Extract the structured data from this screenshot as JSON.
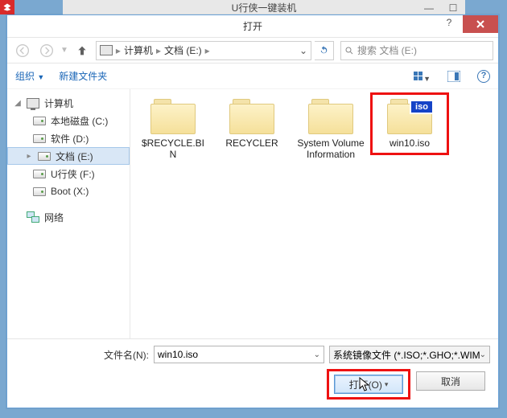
{
  "back_window": {
    "title": "U行侠一键装机",
    "icon_name": "app-logo"
  },
  "dialog": {
    "title": "打开",
    "help": "?",
    "breadcrumb": {
      "root_icon": "computer",
      "parts": [
        "计算机",
        "文档 (E:)"
      ]
    },
    "search_placeholder": "搜索 文档 (E:)",
    "toolbar": {
      "organize": "组织",
      "new_folder": "新建文件夹"
    },
    "tree": {
      "computer": "计算机",
      "drives": [
        {
          "label": "本地磁盘 (C:)"
        },
        {
          "label": "软件 (D:)"
        },
        {
          "label": "文档 (E:)",
          "selected": true
        },
        {
          "label": "U行侠 (F:)"
        },
        {
          "label": "Boot (X:)"
        }
      ],
      "network": "网络"
    },
    "files": [
      {
        "name": "$RECYCLE.BIN",
        "type": "folder"
      },
      {
        "name": "RECYCLER",
        "type": "folder"
      },
      {
        "name": "System Volume Information",
        "type": "folder"
      },
      {
        "name": "win10.iso",
        "type": "iso",
        "selected": true
      }
    ],
    "filename_label": "文件名(N):",
    "filename_value": "win10.iso",
    "filetype_value": "系统镜像文件 (*.ISO;*.GHO;*.WIM)",
    "open_btn": "打开(O)",
    "cancel_btn": "取消"
  }
}
